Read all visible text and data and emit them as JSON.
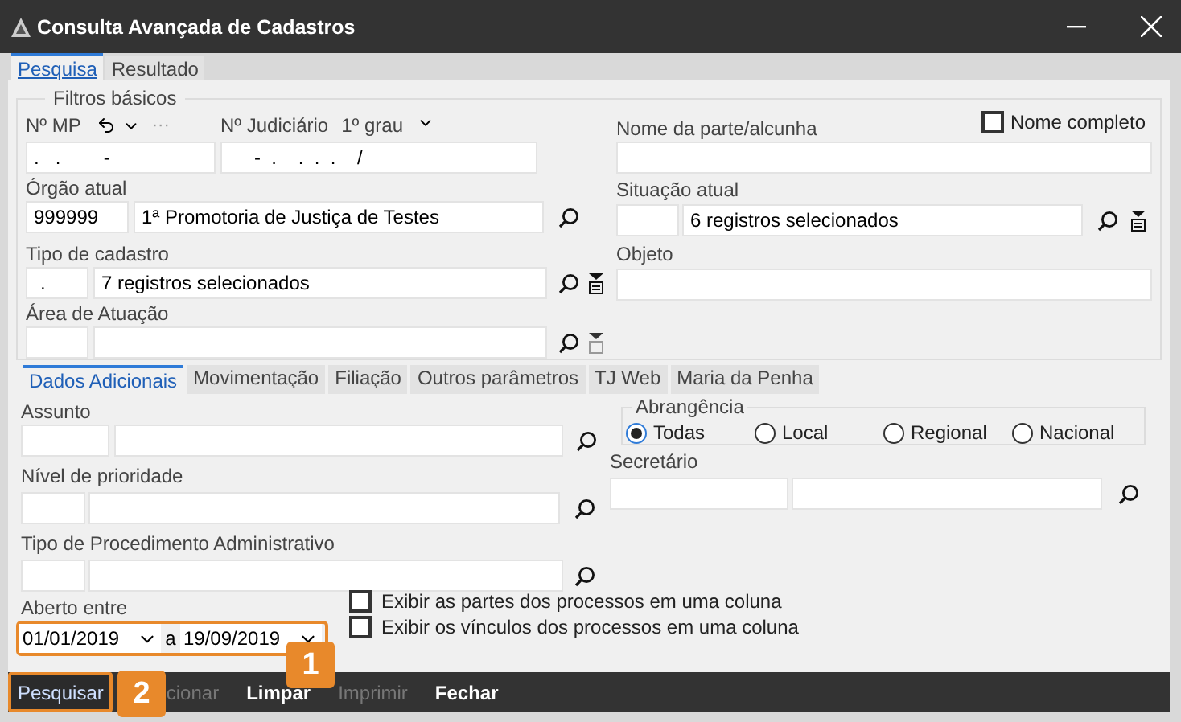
{
  "window": {
    "title": "Consulta Avançada de Cadastros"
  },
  "tabs": [
    {
      "label": "Pesquisa",
      "selected": true
    },
    {
      "label": "Resultado",
      "selected": false
    }
  ],
  "basic_filters": {
    "title": "Filtros básicos",
    "mp": {
      "label": "Nº MP",
      "more": "···",
      "value": ".   .        -"
    },
    "judicial": {
      "label": "Nº Judiciário",
      "degree": "1º grau",
      "value": "-  .    .  .  .    /"
    },
    "orgao": {
      "label": "Órgão atual",
      "code": "999999",
      "value": "1ª Promotoria de Justiça de Testes"
    },
    "tipo": {
      "label": "Tipo de cadastro",
      "code": ".",
      "value": "7 registros selecionados"
    },
    "area": {
      "label": "Área de Atuação"
    },
    "nome": {
      "label": "Nome da parte/alcunha",
      "full_name": {
        "label": "Nome completo",
        "checked": false
      }
    },
    "situacao": {
      "label": "Situação atual",
      "value": "6 registros selecionados"
    },
    "objeto": {
      "label": "Objeto"
    }
  },
  "sub_tabs": [
    {
      "label": "Dados Adicionais",
      "selected": true
    },
    {
      "label": "Movimentação",
      "selected": false
    },
    {
      "label": "Filiação",
      "selected": false
    },
    {
      "label": "Outros parâmetros",
      "selected": false
    },
    {
      "label": "TJ Web",
      "selected": false
    },
    {
      "label": "Maria da Penha",
      "selected": false
    }
  ],
  "additional": {
    "assunto": {
      "label": "Assunto"
    },
    "prioridade": {
      "label": "Nível de prioridade"
    },
    "procedimento": {
      "label": "Tipo de Procedimento Administrativo"
    },
    "abrangencia": {
      "title": "Abrangência",
      "options": [
        {
          "label": "Todas",
          "selected": true
        },
        {
          "label": "Local",
          "selected": false
        },
        {
          "label": "Regional",
          "selected": false
        },
        {
          "label": "Nacional",
          "selected": false
        }
      ]
    },
    "secretario": {
      "label": "Secretário"
    },
    "aberto": {
      "label": "Aberto entre",
      "from": "01/01/2019",
      "separator": "a",
      "to": "19/09/2019"
    },
    "options": [
      {
        "label": "Exibir as partes dos processos em uma coluna",
        "checked": false
      },
      {
        "label": "Exibir os vínculos dos processos em uma coluna",
        "checked": false
      }
    ]
  },
  "actions": [
    {
      "label": "Pesquisar",
      "disabled": false
    },
    {
      "label": "cionar",
      "disabled": true
    },
    {
      "label": "Limpar",
      "disabled": false
    },
    {
      "label": "Imprimir",
      "disabled": true
    },
    {
      "label": "Fechar",
      "disabled": false
    }
  ],
  "callouts": [
    "1",
    "2"
  ]
}
